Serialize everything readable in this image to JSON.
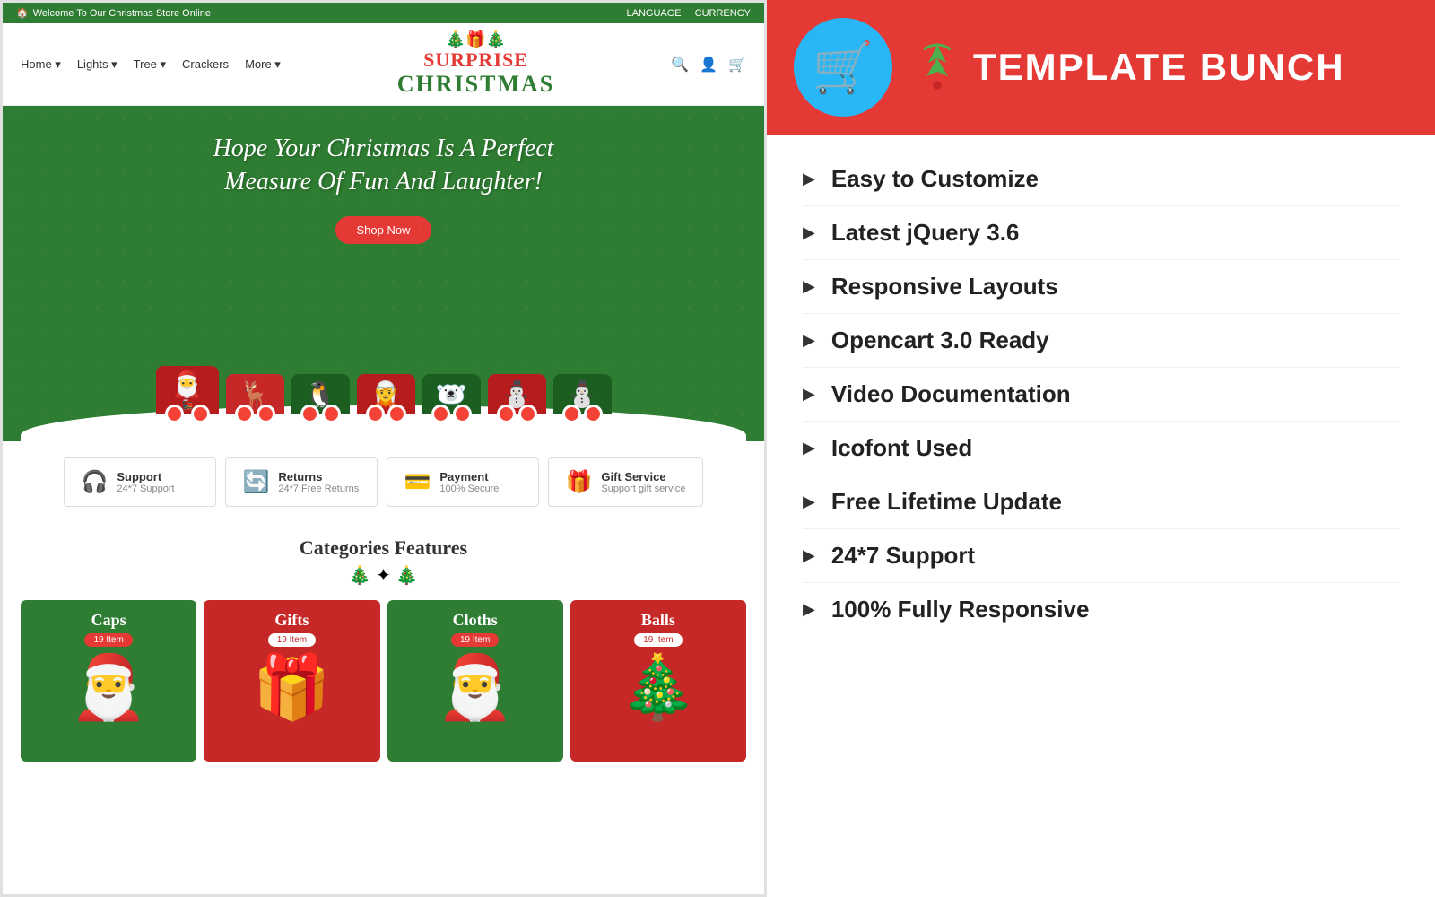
{
  "topbar": {
    "left_text": "Welcome To Our Christmas Store Online",
    "language": "LANGUAGE",
    "currency": "CURRENCY"
  },
  "navbar": {
    "links": [
      "Home",
      "Lights",
      "Tree",
      "Crackers",
      "More"
    ],
    "logo_line1": "SURPRISE",
    "logo_line2": "CHRISTMAS"
  },
  "hero": {
    "tagline_line1": "Hope Your Christmas Is A Perfect",
    "tagline_line2": "Measure Of Fun And Laughter!",
    "shop_button": "Shop Now"
  },
  "services": [
    {
      "icon": "🎧",
      "title": "Support",
      "sub": "24*7 Support"
    },
    {
      "icon": "🔄",
      "title": "Returns",
      "sub": "24*7 Free Returns"
    },
    {
      "icon": "💳",
      "title": "Payment",
      "sub": "100% Secure"
    },
    {
      "icon": "🎁",
      "title": "Gift Service",
      "sub": "Support gift service"
    }
  ],
  "categories_title": "Categories Features",
  "categories": [
    {
      "name": "Caps",
      "count": "19 Item",
      "bg": "green",
      "emoji": "🎅"
    },
    {
      "name": "Gifts",
      "count": "19 Item",
      "bg": "red",
      "emoji": "🎁"
    },
    {
      "name": "Cloths",
      "count": "19 Item",
      "bg": "green",
      "emoji": "🎅"
    },
    {
      "name": "Balls",
      "count": "19 Item",
      "bg": "red",
      "emoji": "🎄"
    }
  ],
  "brand": {
    "name": "TEMPLATE BUNCH"
  },
  "features": [
    {
      "text": "Easy to Customize"
    },
    {
      "text": "Latest jQuery 3.6"
    },
    {
      "text": "Responsive Layouts"
    },
    {
      "text": "Opencart 3.0 Ready"
    },
    {
      "text": "Video Documentation"
    },
    {
      "text": "Icofont Used"
    },
    {
      "text": "Free Lifetime Update"
    },
    {
      "text": "24*7 Support"
    },
    {
      "text": "100% Fully Responsive"
    }
  ]
}
